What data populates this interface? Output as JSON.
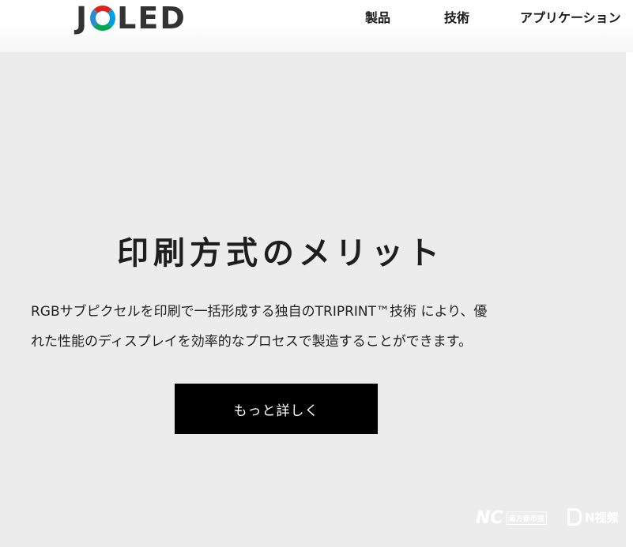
{
  "brand": {
    "logo_text": "JOLED",
    "logo_prefix": "J",
    "logo_suffix": "LED"
  },
  "nav": {
    "items": [
      "製品",
      "技術",
      "アプリケーション"
    ]
  },
  "hero": {
    "title": "印刷方式のメリット",
    "description_lines": [
      "RGBサブピクセルを印刷で一括形成する独自のTRIPRINT™技術 により、優",
      "れた性能のディスプレイを効率的なプロセスで製造することができます。"
    ],
    "button_label": "もっと詳しく"
  },
  "watermarks": {
    "left_text": "NC",
    "left_tag": "南方都市报",
    "right_text": "N视频"
  },
  "colors": {
    "hero_bg": "#ececec",
    "button_bg": "#000000",
    "logo_red": "#e2231a",
    "logo_blue": "#00a0e9",
    "logo_green": "#00a651"
  }
}
